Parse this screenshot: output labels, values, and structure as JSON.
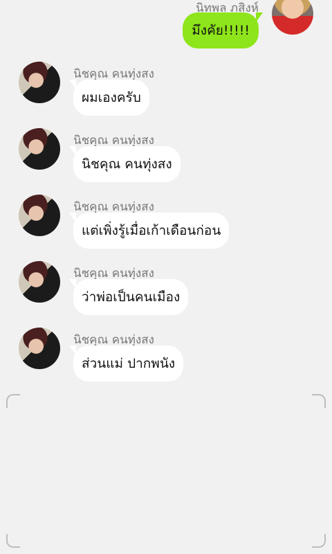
{
  "outgoing": {
    "sender": "นิทพล ภูสิงห์",
    "text": "มึงคัย!!!!!",
    "bubble_color": "#8ee51b"
  },
  "incoming": [
    {
      "sender": "นิชคุณ คนทุ่งสง",
      "text": "ผมเองครับ"
    },
    {
      "sender": "นิชคุณ คนทุ่งสง",
      "text": "นิชคุณ คนทุ่งสง"
    },
    {
      "sender": "นิชคุณ คนทุ่งสง",
      "text": "แต่เพิ่งรู้เมื่อเก้าเดือนก่อน"
    },
    {
      "sender": "นิชคุณ คนทุ่งสง",
      "text": "ว่าพ่อเป็นคนเมือง"
    },
    {
      "sender": "นิชคุณ คนทุ่งสง",
      "text": "ส่วนแม่ ปากพนัง"
    }
  ]
}
